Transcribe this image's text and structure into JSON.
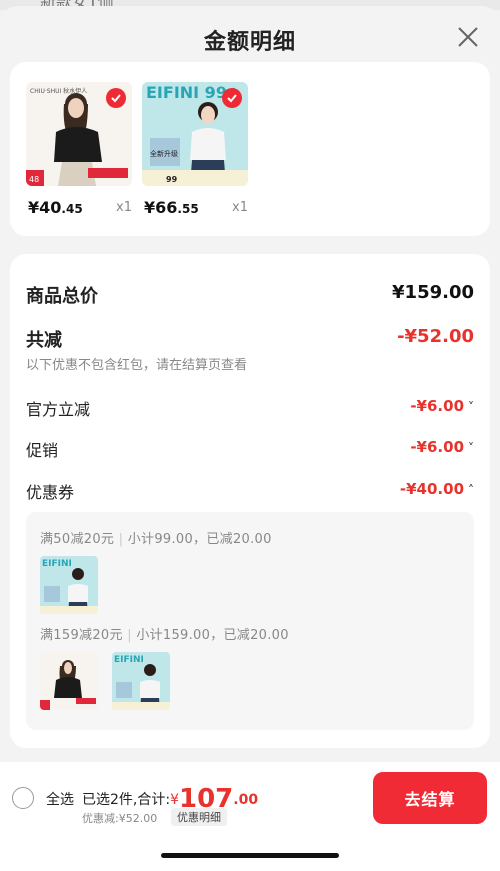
{
  "header": {
    "peek_text": "新款女T恤",
    "title": "金额明细"
  },
  "products": [
    {
      "brand": "CHIU·SHUI 秋水伊人",
      "tag": "48",
      "price_int": "¥40",
      "price_dec": ".45",
      "qty": "x1",
      "checked": true
    },
    {
      "brand": "EIFINI 99+",
      "promo": "全新升级",
      "tag": "99",
      "price_int": "¥66",
      "price_dec": ".55",
      "qty": "x1",
      "checked": true
    }
  ],
  "summary": {
    "total_label": "商品总价",
    "total_value": "¥159.00",
    "discount_label": "共减",
    "discount_value": "-¥52.00",
    "discount_note": "以下优惠不包含红包，请在结算页查看",
    "items": [
      {
        "label": "官方立减",
        "value": "-¥6.00",
        "chevron": "˅"
      },
      {
        "label": "促销",
        "value": "-¥6.00",
        "chevron": "˅"
      },
      {
        "label": "优惠券",
        "value": "-¥40.00",
        "chevron": "˄"
      }
    ]
  },
  "coupons": [
    {
      "rule": "满50减20元",
      "detail": "小计99.00，已减20.00"
    },
    {
      "rule": "满159减20元",
      "detail": "小计159.00，已减20.00"
    }
  ],
  "bottom": {
    "select_all": "全选",
    "selected_text": "已选2件,合计:",
    "currency": "¥",
    "total_int": "107",
    "total_dec": ".00",
    "saved_text": "优惠减:¥52.00",
    "detail_button": "优惠明细",
    "checkout_button": "去结算"
  },
  "colors": {
    "accent_red": "#e8322d",
    "button_red": "#f12b35",
    "teal": "#8fd3d6"
  }
}
